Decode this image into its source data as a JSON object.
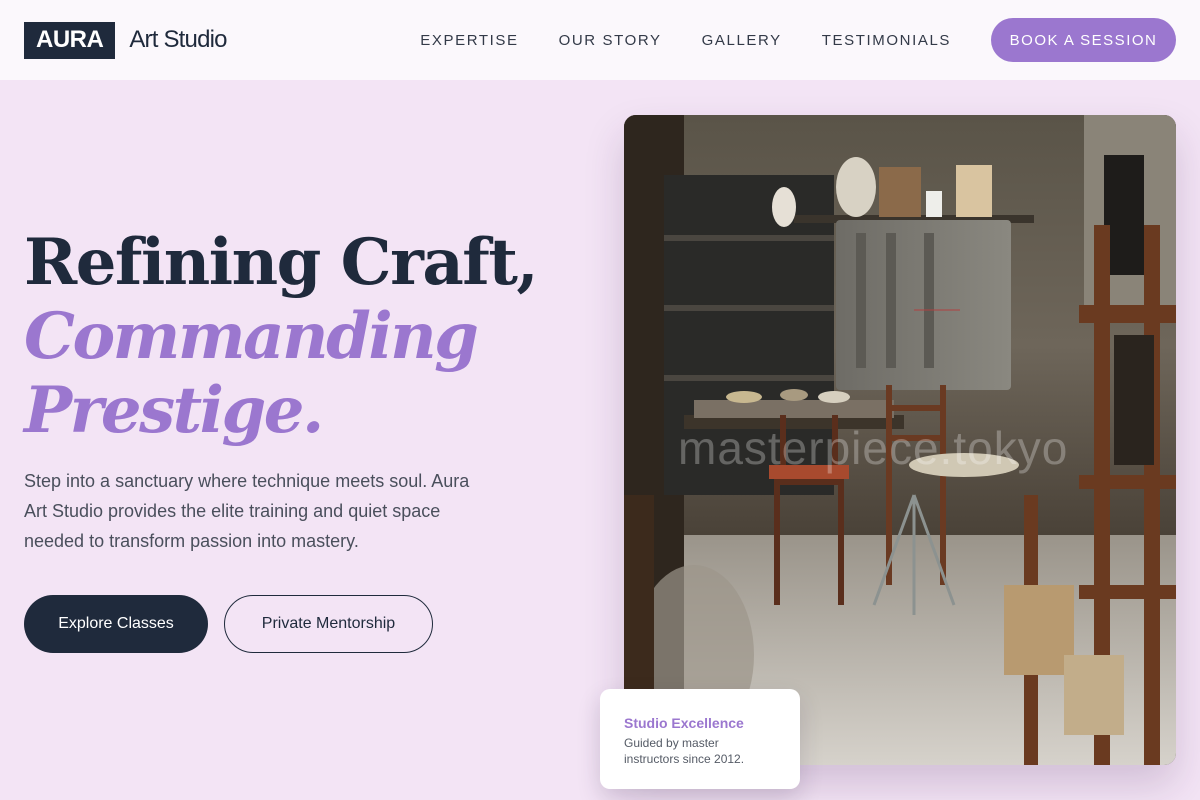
{
  "brand": {
    "mark": "AURA",
    "name": "Art Studio"
  },
  "nav": {
    "links": [
      "EXPERTISE",
      "OUR STORY",
      "GALLERY",
      "TESTIMONIALS"
    ],
    "cta": "BOOK A SESSION"
  },
  "hero": {
    "headline_line1": "Refining Craft,",
    "headline_accent1": "Commanding",
    "headline_accent2": "Prestige.",
    "lede": "Step into a sanctuary where technique meets soul. Aura Art Studio provides the elite training and quiet space needed to transform passion into mastery.",
    "primary_button": "Explore Classes",
    "secondary_button": "Private Mentorship"
  },
  "image": {
    "watermark": "masterpiece.tokyo",
    "subject": "art-studio-interior-photo"
  },
  "card": {
    "title": "Studio Excellence",
    "text": "Guided by master instructors since 2012."
  },
  "colors": {
    "accent": "#9b77cf",
    "navy": "#1f2a3c",
    "background": "#f3e4f5",
    "nav_background": "#fbf8fc"
  }
}
